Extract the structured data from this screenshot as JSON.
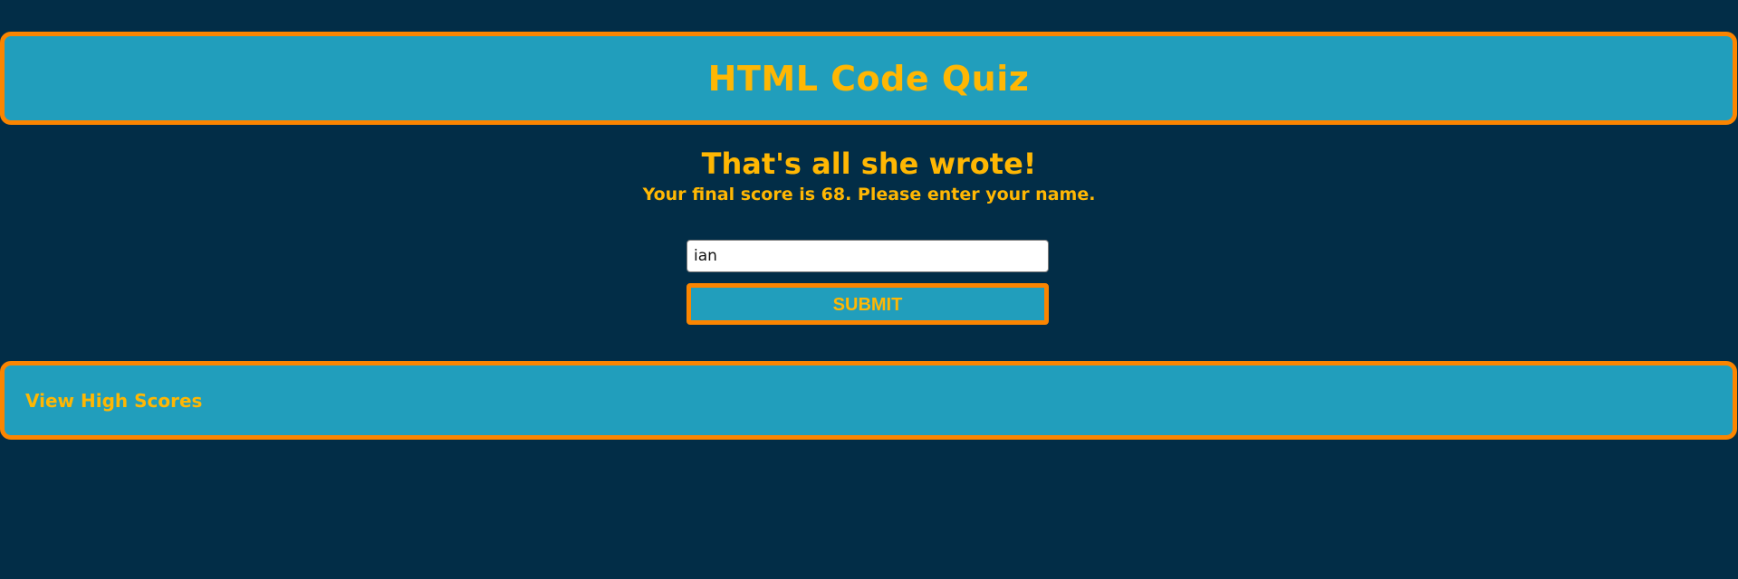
{
  "header": {
    "title": "HTML Code Quiz"
  },
  "end_screen": {
    "title": "That's all she wrote!",
    "message": "Your final score is 68. Please enter your name.",
    "score": 68
  },
  "form": {
    "name_value": "ian",
    "submit_label": "SUBMIT"
  },
  "footer": {
    "high_scores_label": "View High Scores"
  },
  "colors": {
    "background": "#022d47",
    "panel": "#219ebc",
    "border": "#fb8500",
    "text_accent": "#ffb703"
  }
}
